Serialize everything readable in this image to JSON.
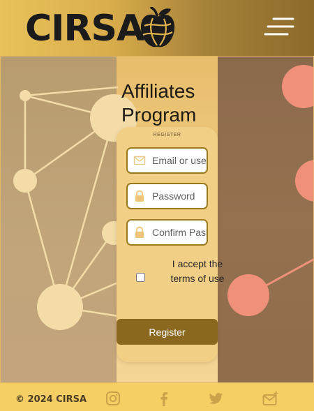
{
  "header": {
    "logo_text": "CIRSA",
    "menu_icon": "hamburger-icon"
  },
  "main": {
    "title_line1": "Affiliates",
    "title_line2": "Program"
  },
  "form": {
    "section_label": "REGISTER",
    "email": {
      "placeholder": "Email or username",
      "icon": "envelope-icon"
    },
    "password": {
      "placeholder": "Password",
      "icon": "lock-icon"
    },
    "confirm_password": {
      "placeholder": "Confirm Password",
      "icon": "lock-icon"
    },
    "terms_label": "I accept the terms of use",
    "terms_checked": false,
    "register_label": "Register"
  },
  "footer": {
    "copyright": "© 2024 CIRSA",
    "social_icons": [
      "instagram-icon",
      "facebook-icon",
      "twitter-icon",
      "mail-plus-icon"
    ]
  },
  "colors": {
    "header_start": "#e8c25a",
    "header_end": "#8d6a2a",
    "card": "#f2cf86",
    "button": "#8b6820",
    "field_border": "#9a7a1c",
    "footer": "#f5cf63",
    "node_light": "#f3dca8",
    "node_coral": "#ef917a"
  }
}
